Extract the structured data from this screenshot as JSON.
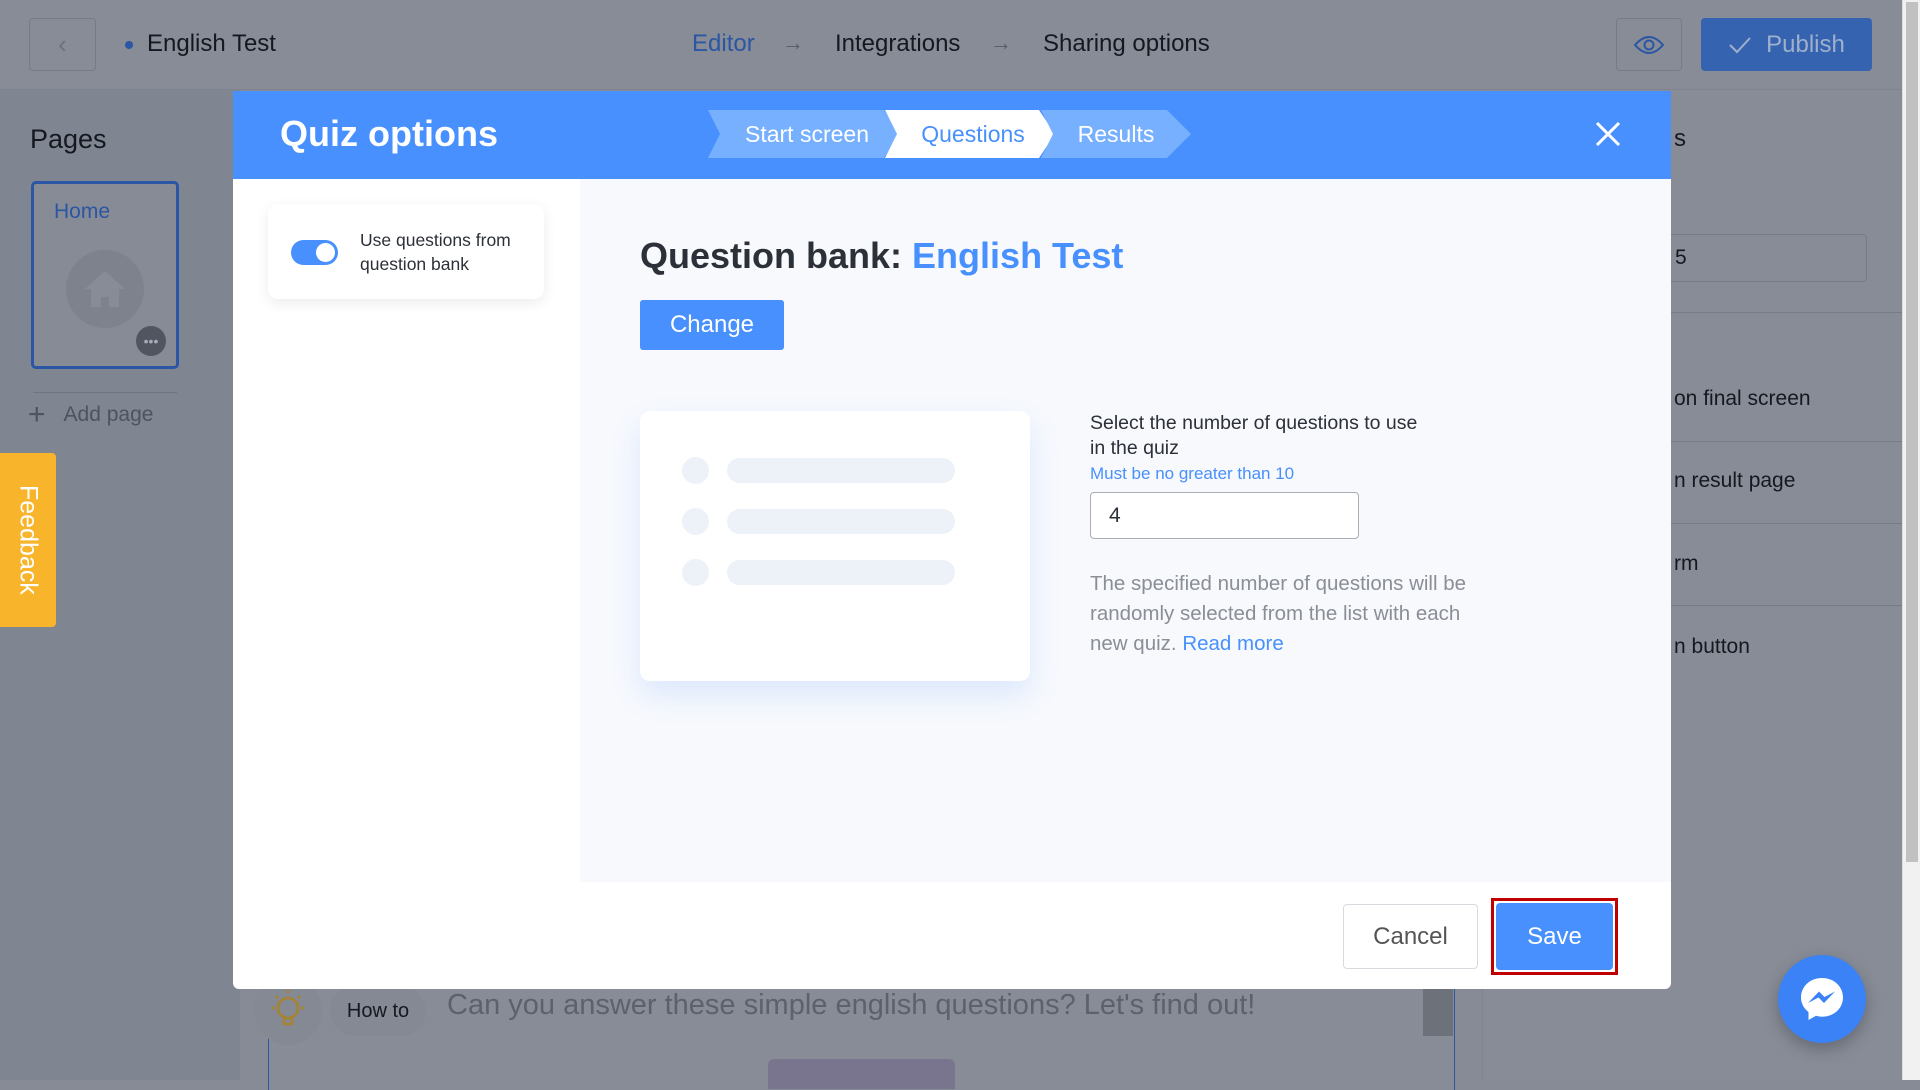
{
  "topbar": {
    "project_name": "English Test",
    "steps": [
      "Editor",
      "Integrations",
      "Sharing options"
    ],
    "active_step": "Editor",
    "publish_label": "Publish"
  },
  "sidebar": {
    "title": "Pages",
    "pages": [
      {
        "label": "Home"
      }
    ],
    "add_page_label": "Add page"
  },
  "right_panel": {
    "heading_partial": "s",
    "input_partial": "5",
    "items": [
      "on final screen",
      "n result page",
      "rm",
      "n button"
    ]
  },
  "canvas": {
    "howto_label": "How to",
    "quiz_text": "Can you answer these simple english questions? Let's find out!"
  },
  "feedback_label": "Feedback",
  "modal": {
    "title": "Quiz options",
    "tabs": [
      {
        "label": "Start screen",
        "active": false
      },
      {
        "label": "Questions",
        "active": true
      },
      {
        "label": "Results",
        "active": false
      }
    ],
    "toggle": {
      "label": "Use questions from question bank",
      "on": true
    },
    "question_bank_prefix": "Question bank:",
    "question_bank_name": "English Test",
    "change_label": "Change",
    "select_label": "Select the number of questions to use in the quiz",
    "hint": "Must be no greater than 10",
    "question_count": "4",
    "description": "The specified number of questions will be randomly selected from the list with each new quiz.",
    "read_more": "Read more",
    "cancel_label": "Cancel",
    "save_label": "Save"
  },
  "colors": {
    "accent": "#4790fd",
    "feedback": "#f8b42b",
    "highlight": "#c00000"
  }
}
